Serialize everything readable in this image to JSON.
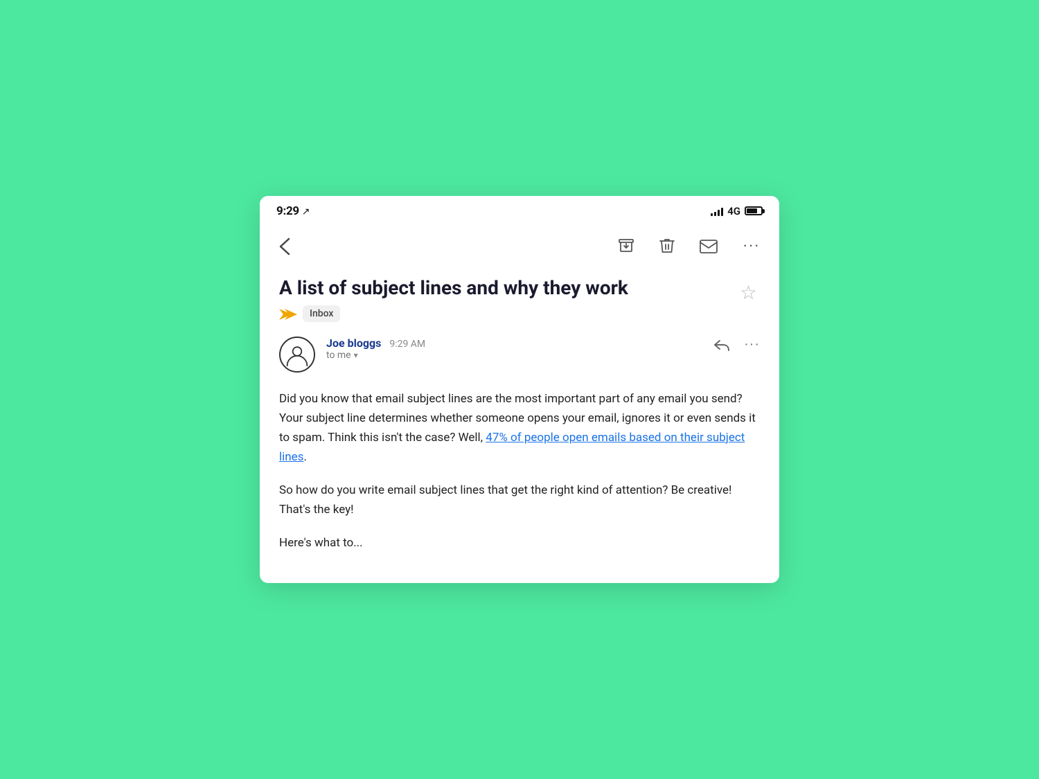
{
  "statusBar": {
    "time": "9:29",
    "locationIcon": "↗",
    "network": "4G",
    "signalBars": [
      4,
      6,
      9,
      12,
      14
    ]
  },
  "toolbar": {
    "backLabel": "‹",
    "archiveLabel": "archive",
    "deleteLabel": "delete",
    "markUnreadLabel": "mark unread",
    "moreLabel": "more"
  },
  "email": {
    "subject": "A list of subject lines and why they work",
    "forwardIndicator": "▶",
    "inboxBadge": "Inbox",
    "starLabel": "☆",
    "sender": {
      "name": "Joe bloggs",
      "time": "9:29 AM",
      "to": "to me",
      "toChevron": "▾"
    },
    "body": {
      "paragraph1": "Did you know that email subject lines are the most important part of any email you send? Your subject line determines whether someone opens your email, ignores it or even sends it to spam. Think this isn't the case? Well, ",
      "linkText": "47% of people open emails based on their subject lines",
      "paragraph1End": ".",
      "paragraph2": "So how do you write email subject lines that get the right kind of attention? Be creative! That's the key!",
      "paragraph3Start": "Here's what to..."
    }
  }
}
